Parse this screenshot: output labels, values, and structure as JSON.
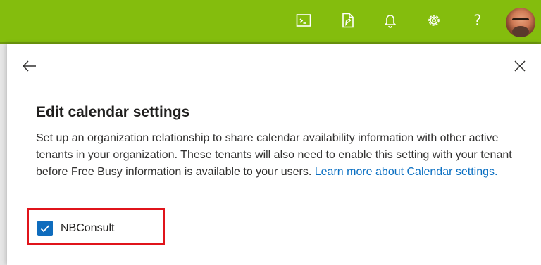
{
  "header": {
    "icons": [
      "cloud-shell-icon",
      "feedback-icon",
      "notifications-icon",
      "settings-icon",
      "help-icon",
      "avatar"
    ],
    "help_glyph": "?",
    "accent_color": "#84bd0d"
  },
  "panel": {
    "title": "Edit calendar settings",
    "description": "Set up an organization relationship to share calendar availability information with other active tenants in your organization. These tenants will also need to enable this setting with your tenant before Free Busy information is available to your users.",
    "learn_more_link": "Learn more about Calendar settings.",
    "checkbox": {
      "label": "NBConsult",
      "checked": true
    },
    "highlight_color": "#e0141b"
  }
}
